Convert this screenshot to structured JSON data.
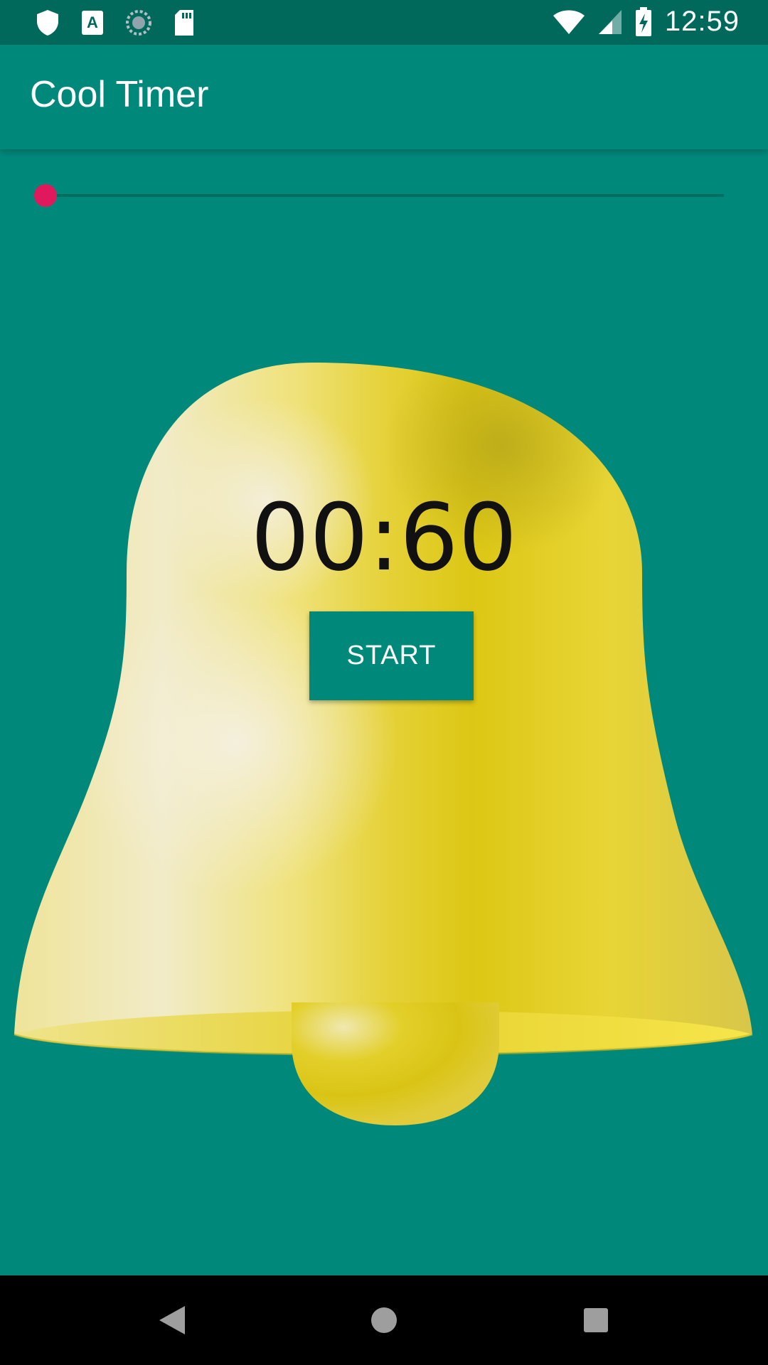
{
  "status_bar": {
    "time": "12:59",
    "left_icons": [
      "shield-icon",
      "text-a-icon",
      "sync-icon",
      "sd-card-icon"
    ],
    "right_icons": [
      "wifi-icon",
      "cell-signal-icon",
      "battery-charging-icon"
    ]
  },
  "app_bar": {
    "title": "Cool Timer"
  },
  "slider": {
    "value_fraction": 0,
    "thumb_color": "#e0185c"
  },
  "timer": {
    "display": "00:60"
  },
  "start_button": {
    "label": "START"
  },
  "nav_bar": {
    "buttons": [
      "back-icon",
      "home-icon",
      "recents-icon"
    ]
  },
  "colors": {
    "primary": "#00897b",
    "primary_dark": "#00695c",
    "accent": "#e0185c",
    "bell": "#e3cc1e"
  }
}
